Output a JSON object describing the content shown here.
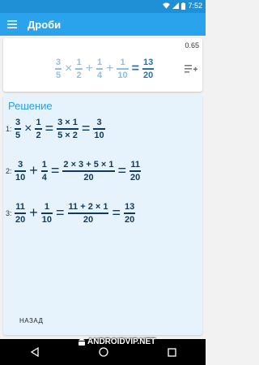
{
  "status": {
    "time": "7:52"
  },
  "app_bar": {
    "title": "Дроби"
  },
  "input": {
    "decimal": "0.65",
    "terms": [
      {
        "n": "3",
        "d": "5"
      },
      {
        "op": "×"
      },
      {
        "n": "1",
        "d": "2"
      },
      {
        "op": "+"
      },
      {
        "n": "1",
        "d": "4"
      },
      {
        "op": "+"
      },
      {
        "n": "1",
        "d": "10"
      },
      {
        "op": "="
      },
      {
        "n": "13",
        "d": "20"
      }
    ]
  },
  "solution": {
    "title": "Решение",
    "steps": [
      {
        "num": "1:",
        "a": {
          "n": "3",
          "d": "5"
        },
        "op": "×",
        "b": {
          "n": "1",
          "d": "2"
        },
        "mid": {
          "n": "3 × 1",
          "d": "5 × 2"
        },
        "res": {
          "n": "3",
          "d": "10"
        }
      },
      {
        "num": "2:",
        "a": {
          "n": "3",
          "d": "10"
        },
        "op": "+",
        "b": {
          "n": "1",
          "d": "4"
        },
        "mid": {
          "n": "2 × 3 + 5 × 1",
          "d": "20"
        },
        "res": {
          "n": "11",
          "d": "20"
        }
      },
      {
        "num": "3:",
        "a": {
          "n": "11",
          "d": "20"
        },
        "op": "+",
        "b": {
          "n": "1",
          "d": "10"
        },
        "mid": {
          "n": "11 + 2 × 1",
          "d": "20"
        },
        "res": {
          "n": "13",
          "d": "20"
        }
      }
    ],
    "eq": "=",
    "back_label": "НАЗАД"
  },
  "watermark": "ANDROIDVIP.NET",
  "icons": [
    "menu-icon",
    "wifi-icon",
    "signal-icon",
    "battery-icon",
    "add-list-icon",
    "nav-back-icon",
    "nav-home-icon",
    "nav-recents-icon"
  ]
}
